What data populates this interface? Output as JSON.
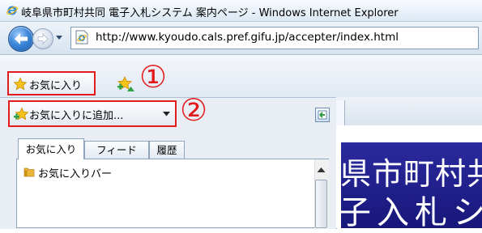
{
  "window": {
    "title": "岐阜県市町村共同 電子入札システム 案内ページ - Windows Internet Explorer"
  },
  "address_bar": {
    "url": "http://www.kyoudo.cals.pref.gifu.jp/accepter/index.html"
  },
  "favorites_bar": {
    "favorites_label": "お気に入り"
  },
  "favorites_pane": {
    "add_to_favorites_label": "お気に入りに追加...",
    "tabs": [
      {
        "label": "お気に入り"
      },
      {
        "label": "フィード"
      },
      {
        "label": "履歴"
      }
    ],
    "items": [
      {
        "label": "お気に入りバー",
        "icon": "folder-icon"
      }
    ]
  },
  "callouts": {
    "one": "①",
    "two": "②"
  },
  "page_banner": {
    "line1": "県市町村共",
    "line2": "子入札シ"
  },
  "colors": {
    "highlight": "#e21c1c",
    "banner_bg": "#1f1f8c"
  },
  "icons": [
    "ie-logo-icon",
    "back-arrow-icon",
    "forward-arrow-icon",
    "dropdown-icon",
    "page-icon",
    "star-icon",
    "add-favorite-icon",
    "chevron-down-icon",
    "pin-pane-icon",
    "folder-icon",
    "scroll-up-icon"
  ]
}
